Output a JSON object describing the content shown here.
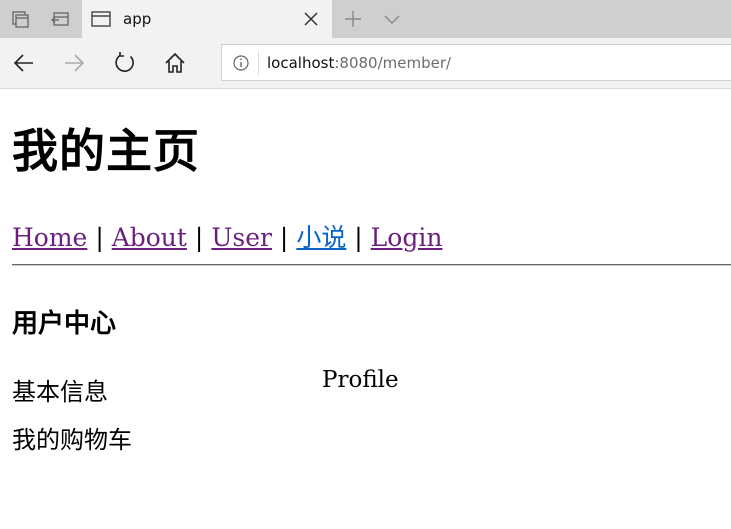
{
  "browser": {
    "tab": {
      "title": "app"
    },
    "address": {
      "host": "localhost",
      "rest": ":8080/member/"
    }
  },
  "page": {
    "title": "我的主页",
    "nav": [
      {
        "label": "Home"
      },
      {
        "label": "About"
      },
      {
        "label": "User"
      },
      {
        "label": "小说"
      },
      {
        "label": "Login"
      }
    ],
    "nav_separator": "|",
    "section_title": "用户中心",
    "menu": [
      {
        "label": "基本信息"
      },
      {
        "label": "我的购物车"
      }
    ],
    "view_content": "Profile"
  },
  "colors": {
    "visited_link": "#6b1f7c",
    "link": "#0b63c8"
  }
}
